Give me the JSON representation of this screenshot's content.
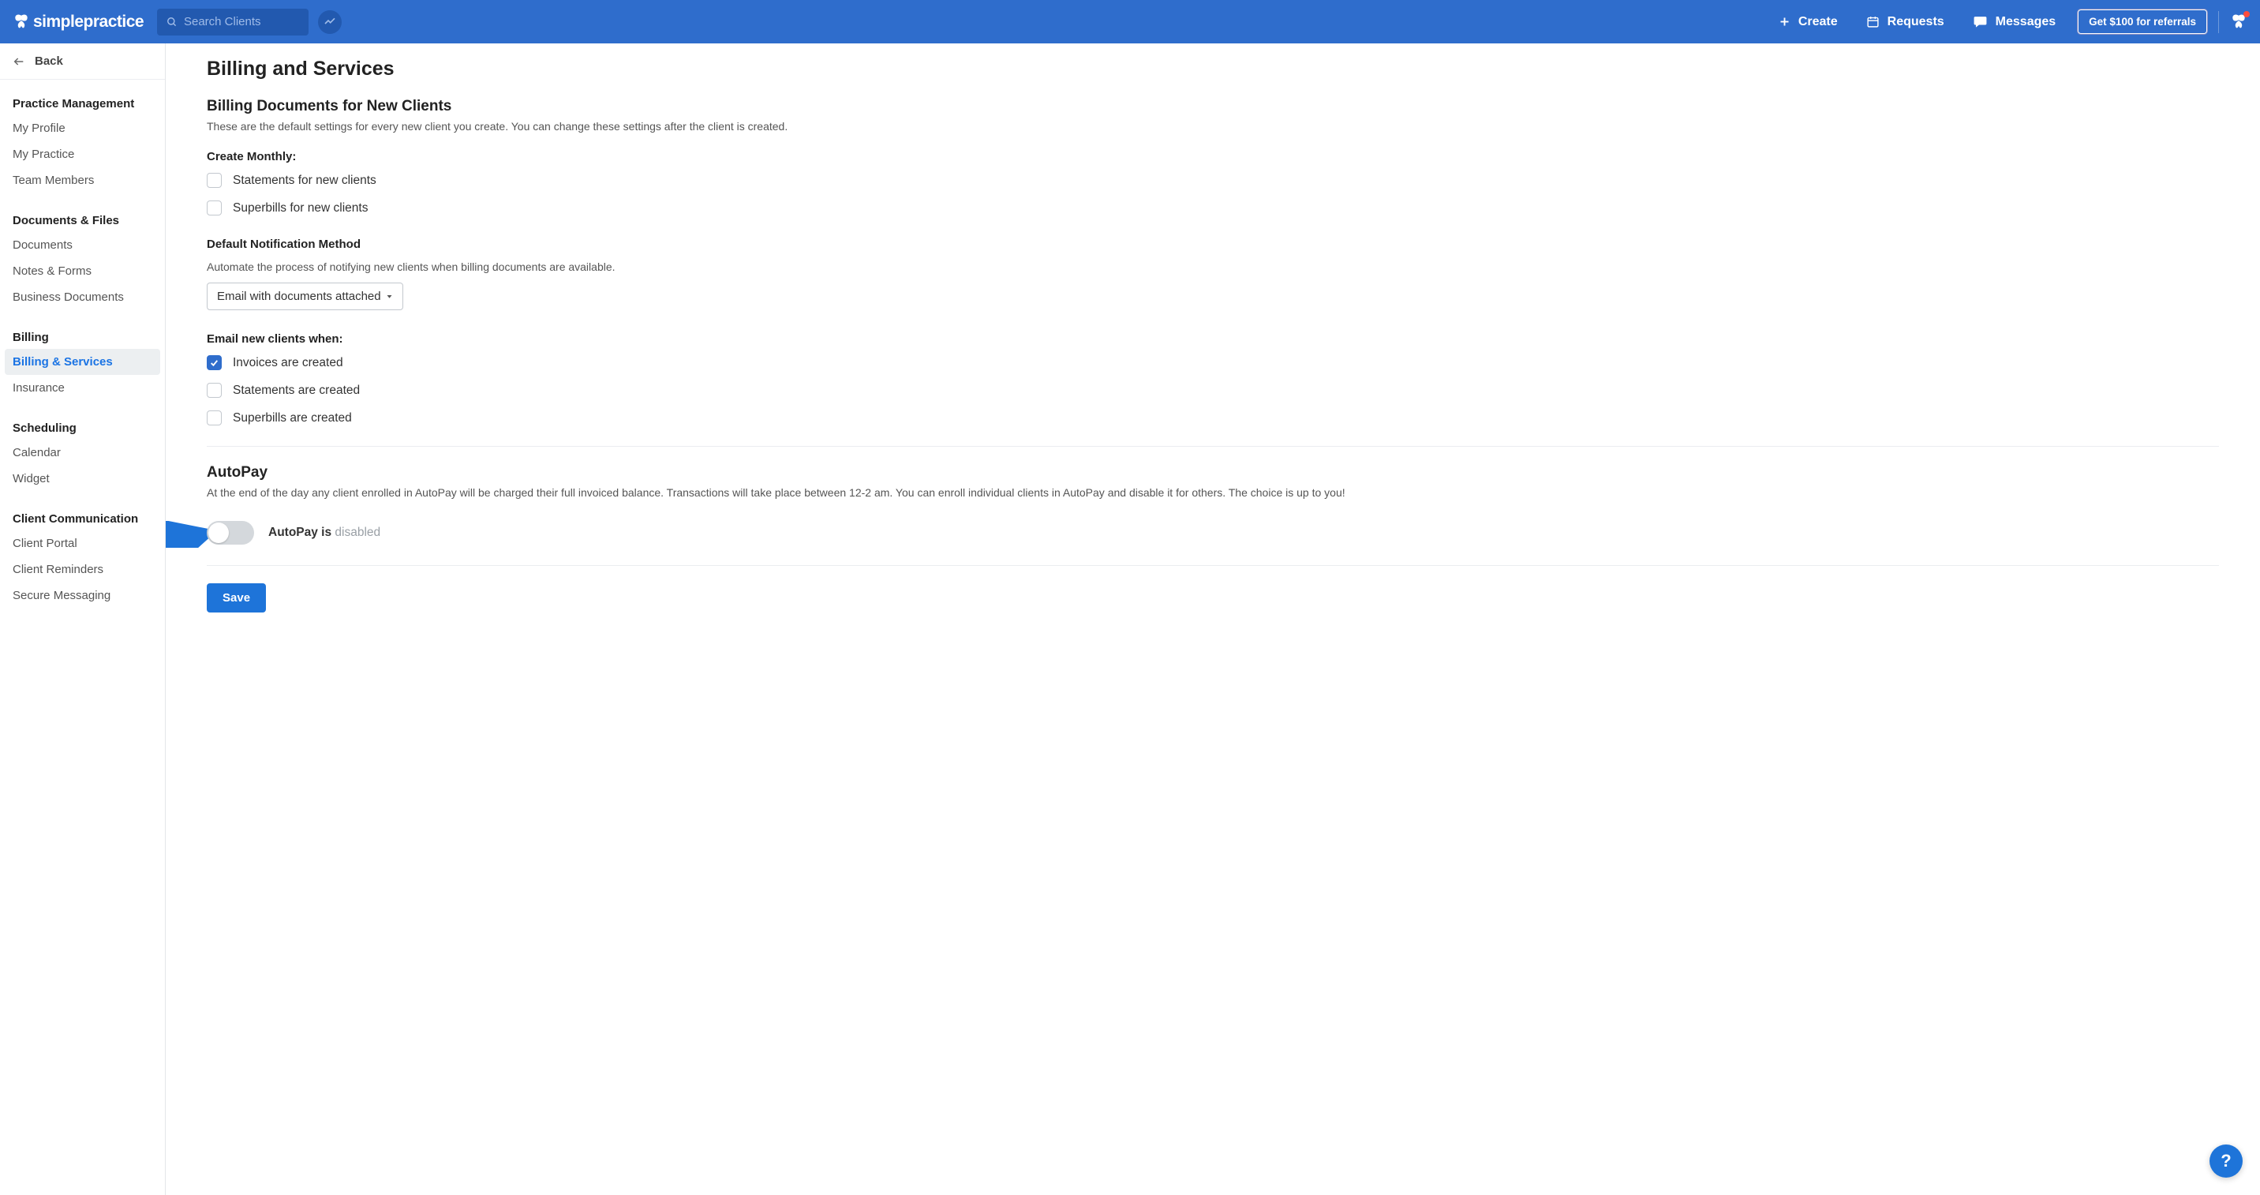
{
  "topbar": {
    "brand": "simplepractice",
    "search_placeholder": "Search Clients",
    "nav": {
      "create": "Create",
      "requests": "Requests",
      "messages": "Messages",
      "referral": "Get $100 for referrals"
    }
  },
  "sidebar": {
    "back": "Back",
    "sections": [
      {
        "title": "Practice Management",
        "items": [
          "My Profile",
          "My Practice",
          "Team Members"
        ]
      },
      {
        "title": "Documents & Files",
        "items": [
          "Documents",
          "Notes & Forms",
          "Business Documents"
        ]
      },
      {
        "title": "Billing",
        "items": [
          "Billing & Services",
          "Insurance"
        ],
        "active_index": 0
      },
      {
        "title": "Scheduling",
        "items": [
          "Calendar",
          "Widget"
        ]
      },
      {
        "title": "Client Communication",
        "items": [
          "Client Portal",
          "Client Reminders",
          "Secure Messaging"
        ]
      }
    ]
  },
  "main": {
    "page_title": "Billing and Services",
    "billing_docs": {
      "title": "Billing Documents for New Clients",
      "desc": "These are the default settings for every new client you create. You can change these settings after the client is created.",
      "create_monthly": {
        "label": "Create Monthly:",
        "options": [
          {
            "label": "Statements for new clients",
            "checked": false
          },
          {
            "label": "Superbills for new clients",
            "checked": false
          }
        ]
      },
      "notification_method": {
        "label": "Default Notification Method",
        "desc": "Automate the process of notifying new clients when billing documents are available.",
        "selected": "Email with documents attached"
      },
      "email_when": {
        "label": "Email new clients when:",
        "options": [
          {
            "label": "Invoices are created",
            "checked": true
          },
          {
            "label": "Statements are created",
            "checked": false
          },
          {
            "label": "Superbills are created",
            "checked": false
          }
        ]
      }
    },
    "autopay": {
      "title": "AutoPay",
      "desc": "At the end of the day any client enrolled in AutoPay will be charged their full invoiced balance. Transactions will take place between 12-2 am. You can enroll individual clients in AutoPay and disable it for others. The choice is up to you!",
      "toggle_label_prefix": "AutoPay is ",
      "toggle_state": "disabled",
      "enabled": false
    },
    "save_button": "Save"
  },
  "help_fab": "?"
}
